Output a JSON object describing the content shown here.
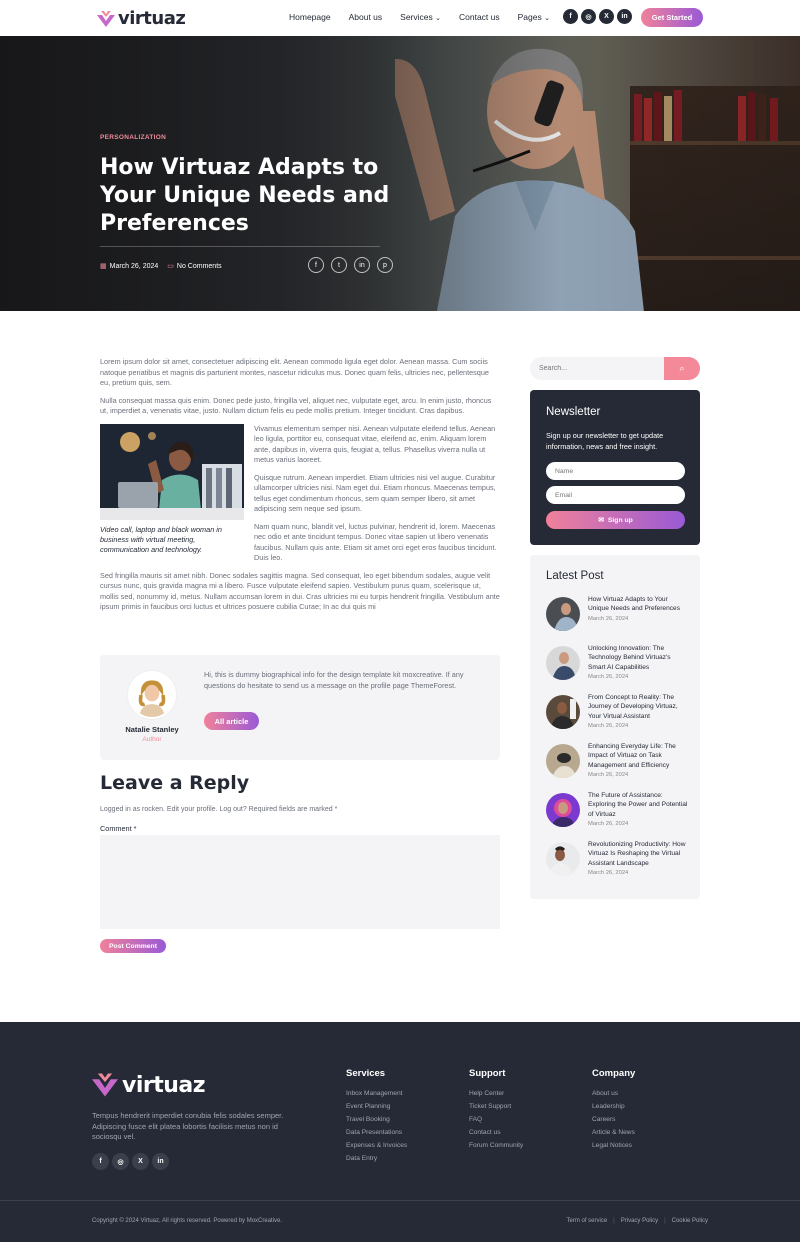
{
  "brand": {
    "name": "virtuaz",
    "accent": "#f08a9a",
    "accent2": "#9a5ad6",
    "dark": "#252a36"
  },
  "nav": {
    "items": [
      "Homepage",
      "About us",
      "Services",
      "Contact us",
      "Pages"
    ],
    "social": [
      "f",
      "ig",
      "X",
      "in"
    ],
    "cta": "Get Started"
  },
  "hero": {
    "category": "PERSONALIZATION",
    "title": "How Virtuaz Adapts to Your Unique Needs and Preferences",
    "date": "March 26, 2024",
    "comments": "No Comments",
    "share": [
      "facebook",
      "twitter",
      "linkedin",
      "pinterest"
    ]
  },
  "article": {
    "p1": "Lorem ipsum dolor sit amet, consectetuer adipiscing elit. Aenean commodo ligula eget dolor. Aenean massa. Cum sociis natoque penatibus et magnis dis parturient montes, nascetur ridiculus mus. Donec quam felis, ultricies nec, pellentesque eu, pretium quis, sem.",
    "p2": "Nulla consequat massa quis enim. Donec pede justo, fringilla vel, aliquet nec, vulputate eget, arcu. In enim justo, rhoncus ut, imperdiet a, venenatis vitae, justo. Nullam dictum felis eu pede mollis pretium. Integer tincidunt. Cras dapibus.",
    "caption": "Video call, laptop and black woman in business with virtual meeting, communication and technology.",
    "p3": "Vivamus elementum semper nisi. Aenean vulputate eleifend tellus. Aenean leo ligula, porttitor eu, consequat vitae, eleifend ac, enim. Aliquam lorem ante, dapibus in, viverra quis, feugiat a, tellus. Phasellus viverra nulla ut metus varius laoreet.",
    "p4": "Quisque rutrum. Aenean imperdiet. Etiam ultricies nisi vel augue. Curabitur ullamcorper ultricies nisi. Nam eget dui. Etiam rhoncus. Maecenas tempus, tellus eget condimentum rhoncus, sem quam semper libero, sit amet adipiscing sem neque sed ipsum.",
    "p5": "Nam quam nunc, blandit vel, luctus pulvinar, hendrerit id, lorem. Maecenas nec odio et ante tincidunt tempus. Donec vitae sapien ut libero venenatis faucibus. Nullam quis ante. Etiam sit amet orci eget eros faucibus tincidunt. Duis leo.",
    "p6": "Sed fringilla mauris sit amet nibh. Donec sodales sagittis magna. Sed consequat, leo eget bibendum sodales, augue velit cursus nunc, quis gravida magna mi a libero. Fusce vulputate eleifend sapien. Vestibulum purus quam, scelerisque ut, mollis sed, nonummy id, metus. Nullam accumsan lorem in dui. Cras ultricies mi eu turpis hendrerit fringilla. Vestibulum ante ipsum primis in faucibus orci luctus et ultrices posuere cubilia Curae; In ac dui quis mi"
  },
  "author": {
    "bio": "Hi, this is dummy biographical info for the design template kit moxcreative. If any questions do hesitate to send us a message on the profile page ThemeForest.",
    "button": "All article",
    "name": "Natalie Stanley",
    "role": "Author"
  },
  "reply": {
    "title": "Leave a Reply",
    "logged": "Logged in as rocken. Edit your profile. Log out? Required fields are marked *",
    "comment_label": "Comment *",
    "button": "Post Comment"
  },
  "sidebar": {
    "search_placeholder": "Search...",
    "newsletter": {
      "title": "Newsletter",
      "text": "Sign up our newsletter to get update information, news and free insight.",
      "name_placeholder": "Name",
      "email_placeholder": "Email",
      "button": "Sign up"
    },
    "latest_title": "Latest Post",
    "posts": [
      {
        "title": "How Virtuaz Adapts to Your Unique Needs and Preferences",
        "date": "March 26, 2024"
      },
      {
        "title": "Unlocking Innovation: The Technology Behind Virtuaz's Smart AI Capabilities",
        "date": "March 26, 2024"
      },
      {
        "title": "From Concept to Reality: The Journey of Developing Virtuaz, Your Virtual Assistant",
        "date": "March 26, 2024"
      },
      {
        "title": "Enhancing Everyday Life: The Impact of Virtuaz on Task Management and Efficiency",
        "date": "March 26, 2024"
      },
      {
        "title": "The Future of Assistance: Exploring the Power and Potential of Virtuaz",
        "date": "March 26, 2024"
      },
      {
        "title": "Revolutionizing Productivity: How Virtuaz Is Reshaping the Virtual Assistant Landscape",
        "date": "March 26, 2024"
      }
    ]
  },
  "footer": {
    "desc": "Tempus hendrerit imperdiet conubia felis sodales semper. Adipiscing fusce elit platea lobortis facilisis metus non id sociosqu vel.",
    "cols": [
      {
        "title": "Services",
        "links": [
          "Inbox Management",
          "Event Planning",
          "Travel Booking",
          "Data Presentations",
          "Expenses & Invoices",
          "Data Entry"
        ]
      },
      {
        "title": "Support",
        "links": [
          "Help Center",
          "Ticket Support",
          "FAQ",
          "Contact us",
          "Forum Community"
        ]
      },
      {
        "title": "Company",
        "links": [
          "About us",
          "Leadership",
          "Careers",
          "Article & News",
          "Legal Notices"
        ]
      }
    ],
    "copyright": "Copyright © 2024 Virtuaz, All rights reserved. Powered by MoxCreative.",
    "legal": [
      "Term of service",
      "Privacy Policy",
      "Cookie Policy"
    ]
  }
}
